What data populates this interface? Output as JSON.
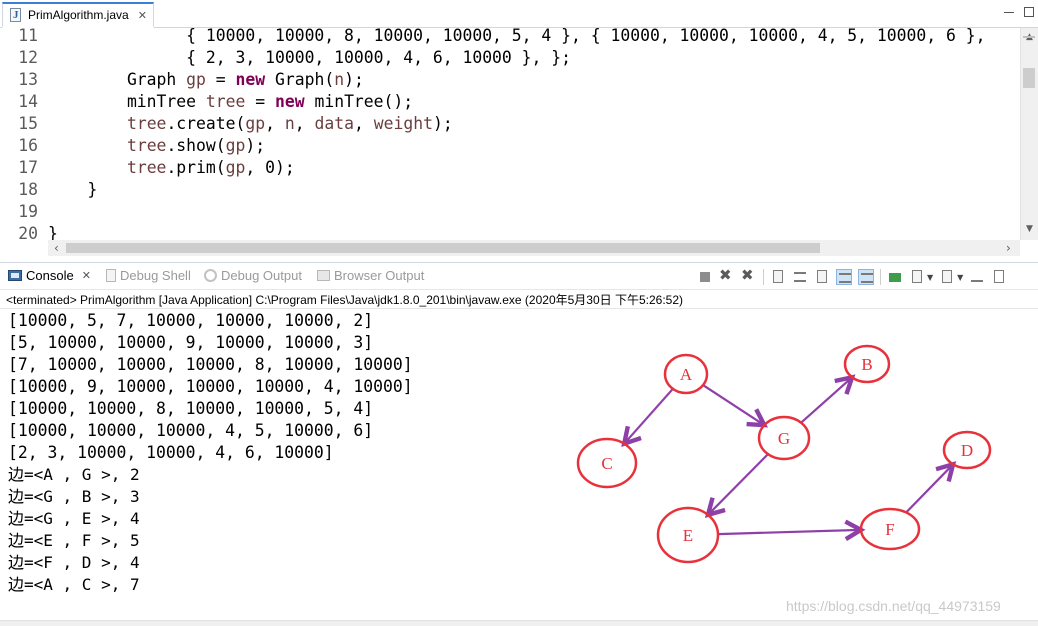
{
  "editor": {
    "tab_label": "PrimAlgorithm.java",
    "tab_close": "✕",
    "lines": [
      {
        "num": "11",
        "parts": [
          {
            "t": "              { 10000, 10000, 8, 10000, 10000, 5, 4 }, { 10000, 10000, 10000, 4, 5, 10000, 6 },",
            "c": ""
          }
        ]
      },
      {
        "num": "12",
        "parts": [
          {
            "t": "              { 2, 3, 10000, 10000, 4, 6, 10000 }, };",
            "c": ""
          }
        ]
      },
      {
        "num": "13",
        "parts": [
          {
            "t": "        Graph ",
            "c": ""
          },
          {
            "t": "gp",
            "c": "var"
          },
          {
            "t": " = ",
            "c": ""
          },
          {
            "t": "new",
            "c": "kw"
          },
          {
            "t": " Graph(",
            "c": ""
          },
          {
            "t": "n",
            "c": "var"
          },
          {
            "t": ");",
            "c": ""
          }
        ]
      },
      {
        "num": "14",
        "parts": [
          {
            "t": "        minTree ",
            "c": ""
          },
          {
            "t": "tree",
            "c": "var"
          },
          {
            "t": " = ",
            "c": ""
          },
          {
            "t": "new",
            "c": "kw"
          },
          {
            "t": " minTree();",
            "c": ""
          }
        ]
      },
      {
        "num": "15",
        "parts": [
          {
            "t": "        ",
            "c": ""
          },
          {
            "t": "tree",
            "c": "var"
          },
          {
            "t": ".create(",
            "c": ""
          },
          {
            "t": "gp",
            "c": "var"
          },
          {
            "t": ", ",
            "c": ""
          },
          {
            "t": "n",
            "c": "var"
          },
          {
            "t": ", ",
            "c": ""
          },
          {
            "t": "data",
            "c": "var"
          },
          {
            "t": ", ",
            "c": ""
          },
          {
            "t": "weight",
            "c": "var"
          },
          {
            "t": ");",
            "c": ""
          }
        ]
      },
      {
        "num": "16",
        "parts": [
          {
            "t": "        ",
            "c": ""
          },
          {
            "t": "tree",
            "c": "var"
          },
          {
            "t": ".show(",
            "c": ""
          },
          {
            "t": "gp",
            "c": "var"
          },
          {
            "t": ");",
            "c": ""
          }
        ]
      },
      {
        "num": "17",
        "parts": [
          {
            "t": "        ",
            "c": ""
          },
          {
            "t": "tree",
            "c": "var"
          },
          {
            "t": ".prim(",
            "c": ""
          },
          {
            "t": "gp",
            "c": "var"
          },
          {
            "t": ", 0);",
            "c": ""
          }
        ]
      },
      {
        "num": "18",
        "parts": [
          {
            "t": "    }",
            "c": ""
          }
        ]
      },
      {
        "num": "19",
        "parts": [
          {
            "t": "",
            "c": ""
          }
        ]
      },
      {
        "num": "20",
        "parts": [
          {
            "t": "}",
            "c": ""
          }
        ]
      }
    ]
  },
  "views": {
    "tabs": [
      {
        "label": "Console",
        "close": "✕",
        "active": true
      },
      {
        "label": "Debug Shell",
        "active": false
      },
      {
        "label": "Debug Output",
        "active": false
      },
      {
        "label": "Browser Output",
        "active": false
      }
    ]
  },
  "console": {
    "status": "<terminated> PrimAlgorithm [Java Application] C:\\Program Files\\Java\\jdk1.8.0_201\\bin\\javaw.exe (2020年5月30日 下午5:26:52)",
    "matrix_rows": [
      "[10000, 5, 7, 10000, 10000, 10000, 2]",
      "[5, 10000, 10000, 9, 10000, 10000, 3]",
      "[7, 10000, 10000, 10000, 8, 10000, 10000]",
      "[10000, 9, 10000, 10000, 10000, 4, 10000]",
      "[10000, 10000, 8, 10000, 10000, 5, 4]",
      "[10000, 10000, 10000, 4, 5, 10000, 6]",
      "[2, 3, 10000, 10000, 4, 6, 10000]"
    ],
    "edge_lines": [
      "边=<A , G >, 2",
      "边=<G , B >, 3",
      "边=<G , E >, 4",
      "边=<E , F >, 5",
      "边=<F , D >, 4",
      "边=<A , C >, 7"
    ]
  },
  "graph": {
    "node_color": "#e8323b",
    "edge_color": "#8e3fa8",
    "nodes": {
      "A": "A",
      "B": "B",
      "C": "C",
      "D": "D",
      "E": "E",
      "F": "F",
      "G": "G"
    }
  },
  "watermark": "https://blog.csdn.net/qq_44973159",
  "colors": {
    "keyword": "#7f0055",
    "variable": "#6a3e3e",
    "tab_accent": "#3c7fd9"
  }
}
